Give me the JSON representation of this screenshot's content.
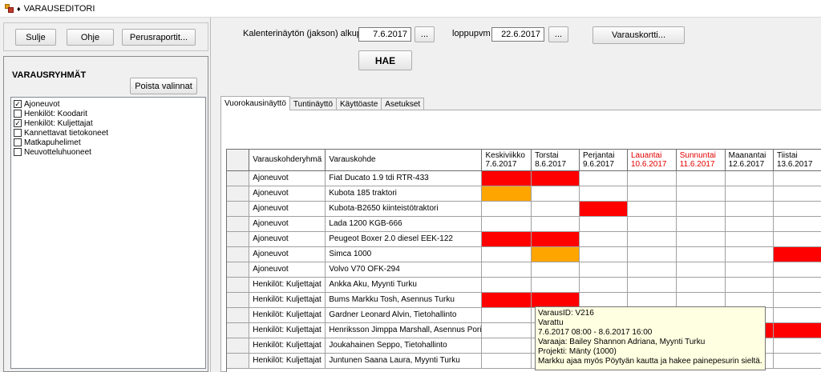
{
  "window": {
    "title": "VARAUSEDITORI"
  },
  "toolbar": {
    "close_label": "Sulje",
    "help_label": "Ohje",
    "reports_label": "Perusraportit..."
  },
  "groups": {
    "title": "VARAUSRYHMÄT",
    "clear_label": "Poista valinnat",
    "items": [
      {
        "label": "Ajoneuvot",
        "checked": "✓"
      },
      {
        "label": "Henkilöt: Koodarit",
        "checked": ""
      },
      {
        "label": "Henkilöt: Kuljettajat",
        "checked": "✓"
      },
      {
        "label": "Kannettavat tietokoneet",
        "checked": ""
      },
      {
        "label": "Matkapuhelimet",
        "checked": ""
      },
      {
        "label": "Neuvotteluhuoneet",
        "checked": ""
      }
    ]
  },
  "search": {
    "start_label": "Kalenterinäytön (jakson) alkupvm",
    "start_value": "7.6.2017",
    "end_label": "loppupvm",
    "end_value": "22.6.2017",
    "browse_label": "...",
    "card_label": "Varauskortti...",
    "fetch_label": "HAE"
  },
  "tabs": [
    {
      "label": "Vuorokausinäyttö"
    },
    {
      "label": "Tuntinäyttö"
    },
    {
      "label": "Käyttöaste"
    },
    {
      "label": "Asetukset"
    }
  ],
  "colors": {
    "booked": "#ff0000",
    "tentative": "#ffa500",
    "weekend": "#e00000"
  },
  "grid": {
    "col_group": "Varauskohderyhmä",
    "col_item": "Varauskohde",
    "days": [
      {
        "name": "Keskiviikko",
        "date": "7.6.2017",
        "weekend": false
      },
      {
        "name": "Torstai",
        "date": "8.6.2017",
        "weekend": false
      },
      {
        "name": "Perjantai",
        "date": "9.6.2017",
        "weekend": false
      },
      {
        "name": "Lauantai",
        "date": "10.6.2017",
        "weekend": true
      },
      {
        "name": "Sunnuntai",
        "date": "11.6.2017",
        "weekend": true
      },
      {
        "name": "Maanantai",
        "date": "12.6.2017",
        "weekend": false
      },
      {
        "name": "Tiistai",
        "date": "13.6.2017",
        "weekend": false
      }
    ],
    "rows": [
      {
        "group": "Ajoneuvot",
        "item": "Fiat Ducato 1.9 tdi RTR-433",
        "cells": [
          "booked",
          "booked",
          "",
          "",
          "",
          "",
          ""
        ]
      },
      {
        "group": "Ajoneuvot",
        "item": "Kubota 185 traktori",
        "cells": [
          "tentative",
          "",
          "",
          "",
          "",
          "",
          ""
        ]
      },
      {
        "group": "Ajoneuvot",
        "item": "Kubota-B2650 kiinteistötraktori",
        "cells": [
          "",
          "",
          "booked",
          "",
          "",
          "",
          ""
        ]
      },
      {
        "group": "Ajoneuvot",
        "item": "Lada 1200 KGB-666",
        "cells": [
          "",
          "",
          "",
          "",
          "",
          "",
          ""
        ]
      },
      {
        "group": "Ajoneuvot",
        "item": "Peugeot Boxer 2.0 diesel EEK-122",
        "cells": [
          "booked",
          "booked",
          "",
          "",
          "",
          "",
          ""
        ]
      },
      {
        "group": "Ajoneuvot",
        "item": "Simca 1000",
        "cells": [
          "",
          "tentative",
          "",
          "",
          "",
          "",
          "booked"
        ]
      },
      {
        "group": "Ajoneuvot",
        "item": "Volvo V70 OFK-294",
        "cells": [
          "",
          "",
          "",
          "",
          "",
          "",
          ""
        ]
      },
      {
        "group": "Henkilöt: Kuljettajat",
        "item": "Ankka Aku, Myynti Turku",
        "cells": [
          "",
          "",
          "",
          "",
          "",
          "",
          ""
        ]
      },
      {
        "group": "Henkilöt: Kuljettajat",
        "item": "Bums Markku Tosh, Asennus Turku",
        "cells": [
          "booked",
          "booked",
          "",
          "",
          "",
          "",
          ""
        ]
      },
      {
        "group": "Henkilöt: Kuljettajat",
        "item": "Gardner Leonard Alvin, Tietohallinto",
        "cells": [
          "",
          "",
          "",
          "",
          "",
          "",
          ""
        ]
      },
      {
        "group": "Henkilöt: Kuljettajat",
        "item": "Henriksson Jimppa Marshall, Asennus Pori",
        "cells": [
          "",
          "",
          "",
          "",
          "",
          "booked",
          "booked"
        ]
      },
      {
        "group": "Henkilöt: Kuljettajat",
        "item": "Joukahainen Seppo, Tietohallinto",
        "cells": [
          "",
          "",
          "",
          "",
          "",
          "",
          ""
        ]
      },
      {
        "group": "Henkilöt: Kuljettajat",
        "item": "Juntunen Saana Laura, Myynti Turku",
        "cells": [
          "",
          "",
          "",
          "",
          "",
          "",
          ""
        ]
      }
    ]
  },
  "tooltip": {
    "id": "VarausID: V216",
    "status": "Varattu",
    "time": "7.6.2017 08:00 - 8.6.2017 16:00",
    "booker": "Varaaja: Bailey Shannon Adriana, Myynti Turku",
    "project": "Projekti: Mänty (1000)",
    "note": "Markku ajaa myös Pöytyän kautta ja hakee painepesurin sieltä."
  }
}
